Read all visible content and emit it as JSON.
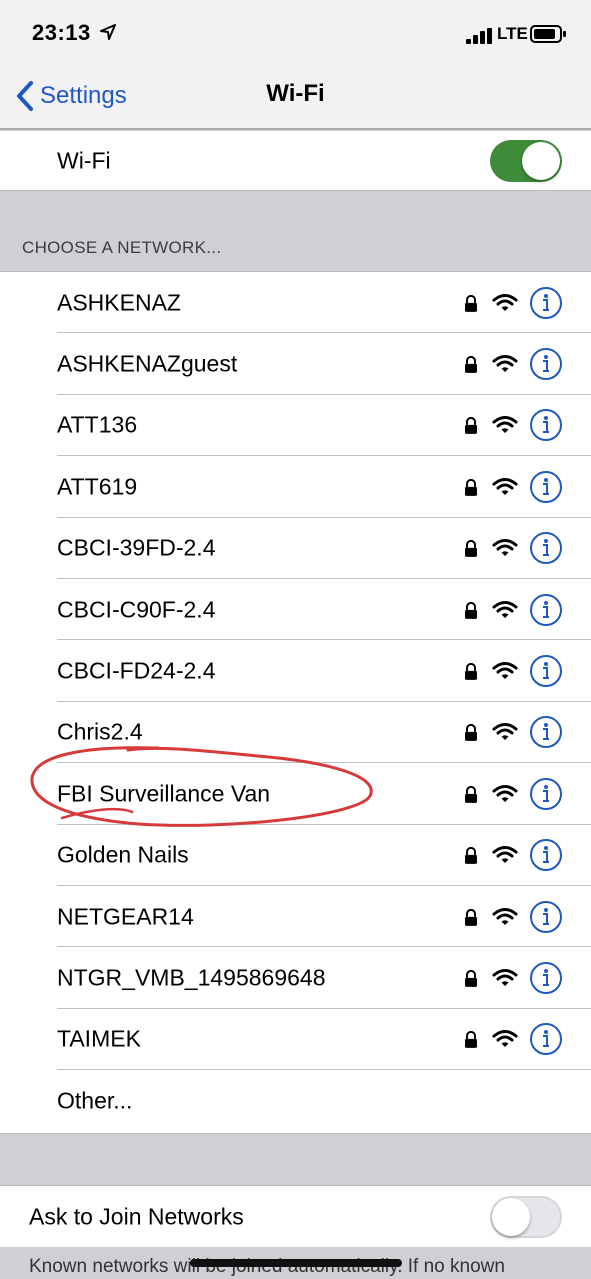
{
  "status_bar": {
    "time": "23:13",
    "network_type": "LTE",
    "location_icon": "location-arrow-icon",
    "signal_icon": "cellular-signal-icon",
    "battery_icon": "battery-icon"
  },
  "nav": {
    "back_label": "Settings",
    "title": "Wi-Fi",
    "accent_color": "#1f58c4"
  },
  "wifi_toggle": {
    "label": "Wi-Fi",
    "state": "on",
    "on_color": "#3e8b3a"
  },
  "choose_header": "CHOOSE A NETWORK...",
  "networks": [
    {
      "name": "ASHKENAZ"
    },
    {
      "name": "ASHKENAZguest"
    },
    {
      "name": "ATT136"
    },
    {
      "name": "ATT619"
    },
    {
      "name": "CBCI-39FD-2.4"
    },
    {
      "name": "CBCI-C90F-2.4"
    },
    {
      "name": "CBCI-FD24-2.4"
    },
    {
      "name": "Chris2.4"
    },
    {
      "name": "FBI Surveillance Van"
    },
    {
      "name": "Golden Nails"
    },
    {
      "name": "NETGEAR14"
    },
    {
      "name": "NTGR_VMB_1495869648"
    },
    {
      "name": "TAIMEK"
    }
  ],
  "other_label": "Other...",
  "ask_to_join": {
    "label": "Ask to Join Networks",
    "state": "off"
  },
  "footer_text": "Known networks will be joined automatically. If no known",
  "annotation_color": "#d63a3a"
}
